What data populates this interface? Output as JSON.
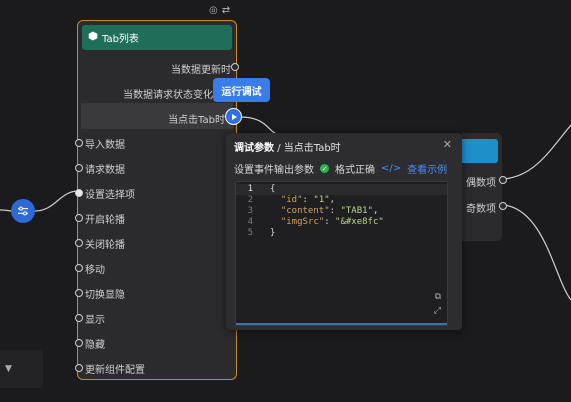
{
  "main_node": {
    "title": "Tab列表",
    "events": [
      "当数据更新时",
      "当数据请求状态变化时",
      "当点击Tab时"
    ],
    "actions": [
      "导入数据",
      "请求数据",
      "设置选择项",
      "开启轮播",
      "关闭轮播",
      "移动",
      "切换显隐",
      "显示",
      "隐藏",
      "更新组件配置"
    ]
  },
  "run_button": {
    "label": "运行调试"
  },
  "debug_panel": {
    "title": "调试参数",
    "separator": "/",
    "subtitle": "当点击Tab时",
    "output_label": "设置事件输出参数",
    "format_status": "格式正确",
    "example_link": "查看示例",
    "code_lines": [
      {
        "n": "1",
        "text": "{"
      },
      {
        "n": "2",
        "key": "\"id\"",
        "value": "\"1\"",
        "comma": ","
      },
      {
        "n": "3",
        "key": "\"content\"",
        "value": "\"TAB1\"",
        "comma": ","
      },
      {
        "n": "4",
        "key": "\"imgSrc\"",
        "value": "\"&#xe8fc\"",
        "comma": ""
      },
      {
        "n": "5",
        "text": "}"
      }
    ]
  },
  "right_node": {
    "ports": [
      "偶数项",
      "奇数项"
    ]
  },
  "colors": {
    "node_border": "#c98a2c",
    "node_header": "#1f6e58",
    "accent_blue": "#3a7de8",
    "ok_green": "#2bb24c"
  }
}
